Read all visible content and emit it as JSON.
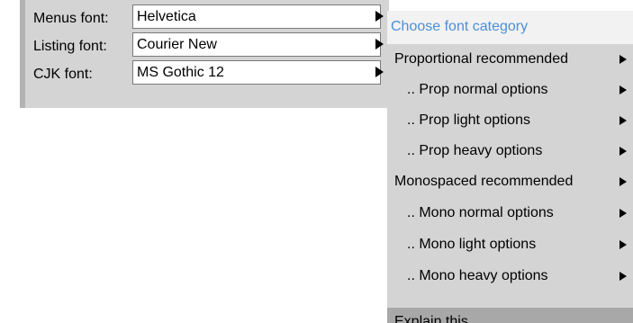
{
  "font_settings": {
    "rows": [
      {
        "label": "Menus font:",
        "value": "Helvetica"
      },
      {
        "label": "Listing font:",
        "value": "Courier New"
      },
      {
        "label": "CJK font:",
        "value": "MS Gothic 12"
      }
    ]
  },
  "category_menu": {
    "header": "Choose font category",
    "items": [
      {
        "label": "Proportional recommended",
        "has_submenu": true
      },
      {
        "label": ".. Prop normal options",
        "has_submenu": true
      },
      {
        "label": ".. Prop light options",
        "has_submenu": true
      },
      {
        "label": ".. Prop heavy options",
        "has_submenu": true
      },
      {
        "label": "Monospaced recommended",
        "has_submenu": true
      },
      {
        "label": ".. Mono normal options",
        "has_submenu": true
      },
      {
        "label": ".. Mono light options",
        "has_submenu": true
      },
      {
        "label": ".. Mono heavy options",
        "has_submenu": true
      }
    ],
    "footer": "Explain this"
  },
  "colors": {
    "panel_background": "#d4d4d4",
    "menu_header_background": "#f2f2f2",
    "menu_header_text": "#4a8fd9",
    "menu_footer_background": "#a8a8a8"
  }
}
